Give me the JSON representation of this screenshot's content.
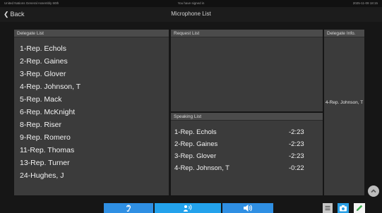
{
  "status_bar": {
    "left": "United Nations General Assembly 60th",
    "center": "You have signed in",
    "right": "2025-11-09 18:15"
  },
  "header": {
    "back_label": "Back",
    "title": "Microphone List"
  },
  "delegate_panel": {
    "title": "Delegate List",
    "items": [
      "1-Rep. Echols",
      "2-Rep. Gaines",
      "3-Rep. Glover",
      "4-Rep. Johnson, T",
      "5-Rep. Mack",
      "6-Rep. McKnight",
      "8-Rep. Riser",
      "9-Rep. Romero",
      "11-Rep. Thomas",
      "13-Rep. Turner",
      "24-Hughes, J"
    ]
  },
  "request_panel": {
    "title": "Request List",
    "items": []
  },
  "speaking_panel": {
    "title": "Speaking List",
    "items": [
      {
        "name": "1-Rep. Echols",
        "time": "-2:23"
      },
      {
        "name": "2-Rep. Gaines",
        "time": "-2:23"
      },
      {
        "name": "3-Rep. Glover",
        "time": "-2:23"
      },
      {
        "name": "4-Rep. Johnson, T",
        "time": "-0:22"
      }
    ]
  },
  "info_panel": {
    "title": "Delegate Info.",
    "selected": "4-Rep. Johnson, T"
  },
  "toolbar": {
    "icons": [
      "ear-icon",
      "speaking-icon",
      "volume-icon",
      "list-icon",
      "camera-icon",
      "edit-icon"
    ]
  },
  "colors": {
    "accent": "#2f8fe3",
    "panel_bg": "#3b3b3b",
    "header_bg": "#4b4b4b"
  }
}
